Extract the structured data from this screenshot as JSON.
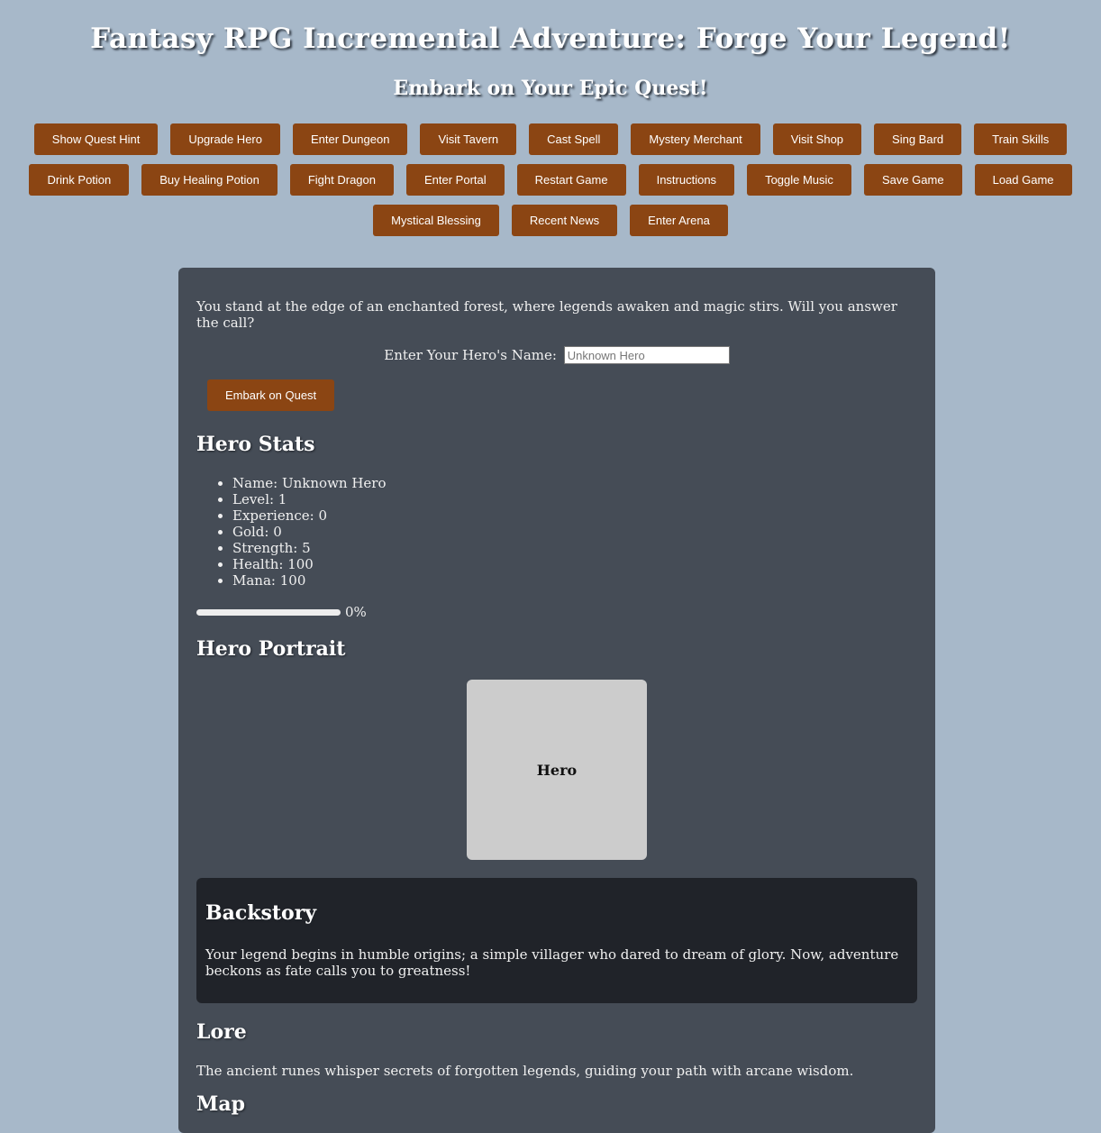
{
  "header": {
    "title": "Fantasy RPG Incremental Adventure: Forge Your Legend!",
    "subtitle": "Embark on Your Epic Quest!"
  },
  "toolbar": {
    "row1": [
      "Show Quest Hint",
      "Upgrade Hero",
      "Enter Dungeon",
      "Visit Tavern",
      "Cast Spell",
      "Mystery Merchant",
      "Visit Shop",
      "Sing Bard",
      "Train Skills"
    ],
    "row2": [
      "Drink Potion",
      "Buy Healing Potion",
      "Fight Dragon",
      "Enter Portal",
      "Restart Game",
      "Instructions",
      "Toggle Music",
      "Save Game",
      "Load Game"
    ],
    "row3": [
      "Mystical Blessing",
      "Recent News",
      "Enter Arena"
    ]
  },
  "intro": {
    "text": "You stand at the edge of an enchanted forest, where legends awaken and magic stirs. Will you answer the call?",
    "name_label": "Enter Your Hero's Name:",
    "name_placeholder": "Unknown Hero",
    "name_value": "",
    "embark_label": "Embark on Quest"
  },
  "stats": {
    "heading": "Hero Stats",
    "items": [
      "Name: Unknown Hero",
      "Level: 1",
      "Experience: 0",
      "Gold: 0",
      "Strength: 5",
      "Health: 100",
      "Mana: 100"
    ],
    "progress_percent": 0,
    "progress_label": "0%"
  },
  "portrait": {
    "heading": "Hero Portrait",
    "label": "Hero"
  },
  "backstory": {
    "heading": "Backstory",
    "text": "Your legend begins in humble origins; a simple villager who dared to dream of glory. Now, adventure beckons as fate calls you to greatness!"
  },
  "lore": {
    "heading": "Lore",
    "text": "The ancient runes whisper secrets of forgotten legends, guiding your path with arcane wisdom."
  },
  "map": {
    "heading": "Map"
  },
  "colors": {
    "background": "#a7b8c9",
    "panel": "#454c56",
    "button": "#8b4513",
    "backstory_box": "#202329",
    "portrait_box": "#cccccc"
  }
}
